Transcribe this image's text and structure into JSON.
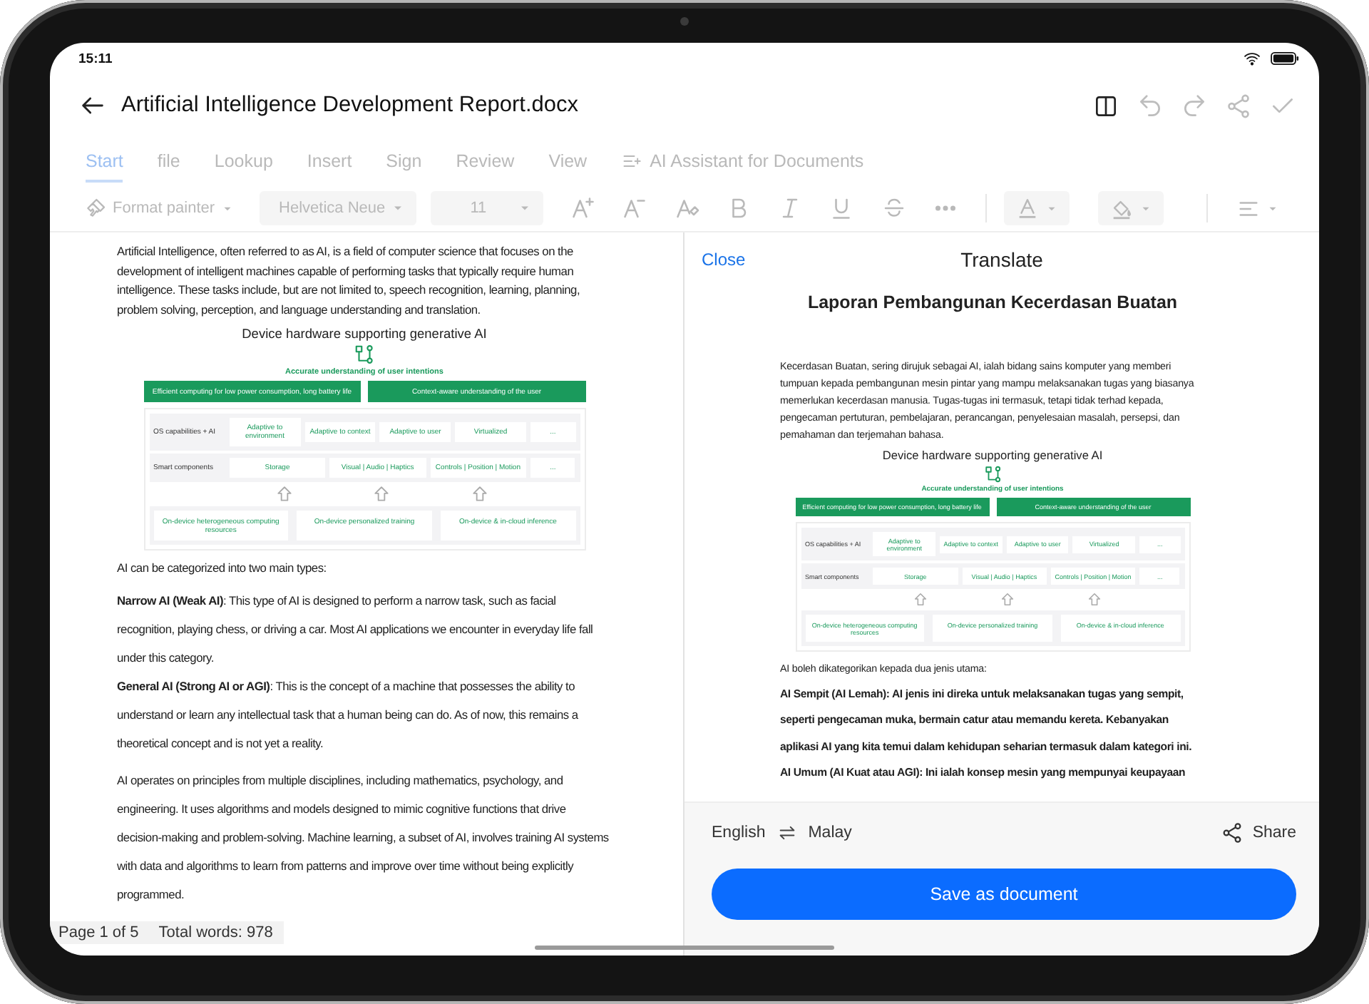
{
  "status_bar": {
    "time": "15:11"
  },
  "title_bar": {
    "title": "Artificial Intelligence Development Report.docx",
    "actions": [
      {
        "kind": "split-view",
        "disabled": false
      },
      {
        "kind": "undo",
        "disabled": true
      },
      {
        "kind": "redo",
        "disabled": true
      },
      {
        "kind": "share",
        "disabled": true
      },
      {
        "kind": "confirm",
        "disabled": true
      }
    ]
  },
  "ribbon": {
    "disabled": true,
    "tabs": [
      {
        "label": "Start",
        "selected": true
      },
      {
        "label": "file",
        "selected": false
      },
      {
        "label": "Lookup",
        "selected": false
      },
      {
        "label": "Insert",
        "selected": false
      },
      {
        "label": "Sign",
        "selected": false
      },
      {
        "label": "Review",
        "selected": false
      },
      {
        "label": "View",
        "selected": false
      }
    ],
    "assistant": "AI Assistant for Documents"
  },
  "toolbar": {
    "disabled": true,
    "format_painter": "Format painter",
    "font": "Helvetica Neue",
    "size": "11"
  },
  "document": {
    "blocks": [
      {
        "kind": "paragraph",
        "text": "Artificial Intelligence, often referred to as AI, is a field of computer science that focuses on the development of intelligent machines capable of performing tasks that typically require human intelligence. These tasks include, but are not limited to, speech recognition, learning, planning, problem solving, perception, and language understanding and translation."
      },
      {
        "kind": "figure",
        "title": "Device hardware supporting generative AI",
        "subtitle": "Accurate understanding of user intentions",
        "banners": [
          "Efficient computing for low power consumption, long battery life",
          "Context-aware understanding of the user"
        ],
        "layers": [
          {
            "label": "OS capabilities + AI",
            "boxes": [
              "Adaptive to environment",
              "Adaptive to context",
              "Adaptive to user",
              "Virtualized",
              "..."
            ]
          },
          {
            "label": "Smart components",
            "boxes": [
              "Storage",
              "Visual | Audio | Haptics",
              "Controls | Position | Motion",
              "..."
            ]
          }
        ],
        "foundation": [
          "On-device heterogeneous computing resources",
          "On-device personalized training",
          "On-device & in-cloud inference"
        ]
      },
      {
        "kind": "paragraph",
        "text": "AI can be categorized into two main types:"
      },
      {
        "kind": "wide",
        "text": "**Narrow AI (Weak AI)**: This type of AI is designed to perform a narrow task, such as facial recognition, playing chess, or driving a car. Most AI applications we encounter in everyday life fall under this category."
      },
      {
        "kind": "wide",
        "text": "**General AI (Strong AI or AGI)**: This is the concept of a machine that possesses the ability to understand or learn any intellectual task that a human being can do. As of now, this remains a theoretical concept and is not yet a reality."
      },
      {
        "kind": "wide",
        "text": "AI operates on principles from multiple disciplines, including mathematics, psychology, and engineering. It uses algorithms and models designed to mimic cognitive functions that drive decision-making and problem-solving. Machine learning, a subset of AI, involves training AI systems with data and algorithms to learn from patterns and improve over time without being explicitly programmed."
      }
    ],
    "page": "Page 1 of 5",
    "words": "Total words: 978"
  },
  "translate_panel": {
    "close": "Close",
    "title": "Translate",
    "blocks": [
      {
        "kind": "heading",
        "text": "Laporan Pembangunan Kecerdasan Buatan"
      },
      {
        "kind": "paragraph",
        "text": "Kecerdasan Buatan, sering dirujuk sebagai AI, ialah bidang sains komputer yang memberi tumpuan kepada pembangunan mesin pintar yang mampu melaksanakan tugas yang biasanya memerlukan kecerdasan manusia. Tugas-tugas ini termasuk, tetapi tidak terhad kepada, pengecaman pertuturan, pembelajaran, perancangan, penyelesaian masalah, persepsi, dan pemahaman dan terjemahan bahasa."
      },
      {
        "kind": "figure",
        "title": "Device hardware supporting generative AI",
        "subtitle": "Accurate understanding of user intentions",
        "banners": [
          "Efficient computing for low power consumption, long battery life",
          "Context-aware understanding of the user"
        ],
        "layers": [
          {
            "label": "OS capabilities + AI",
            "boxes": [
              "Adaptive to environment",
              "Adaptive to context",
              "Adaptive to user",
              "Virtualized",
              "..."
            ]
          },
          {
            "label": "Smart components",
            "boxes": [
              "Storage",
              "Visual | Audio | Haptics",
              "Controls | Position | Motion",
              "..."
            ]
          }
        ],
        "foundation": [
          "On-device heterogeneous computing resources",
          "On-device personalized training",
          "On-device & in-cloud inference"
        ]
      },
      {
        "kind": "paragraph",
        "text": "AI boleh dikategorikan kepada dua jenis utama:"
      },
      {
        "kind": "bold",
        "text": "AI Sempit (AI Lemah): AI jenis ini direka untuk melaksanakan tugas yang sempit, seperti pengecaman muka, bermain catur atau memandu kereta. Kebanyakan aplikasi AI yang kita temui dalam kehidupan seharian termasuk dalam kategori ini."
      },
      {
        "kind": "bold",
        "text": "AI Umum (AI Kuat atau AGI): Ini ialah konsep mesin yang mempunyai keupayaan"
      }
    ],
    "source_language": "English",
    "target_language": "Malay",
    "share": "Share",
    "save": "Save as document"
  }
}
